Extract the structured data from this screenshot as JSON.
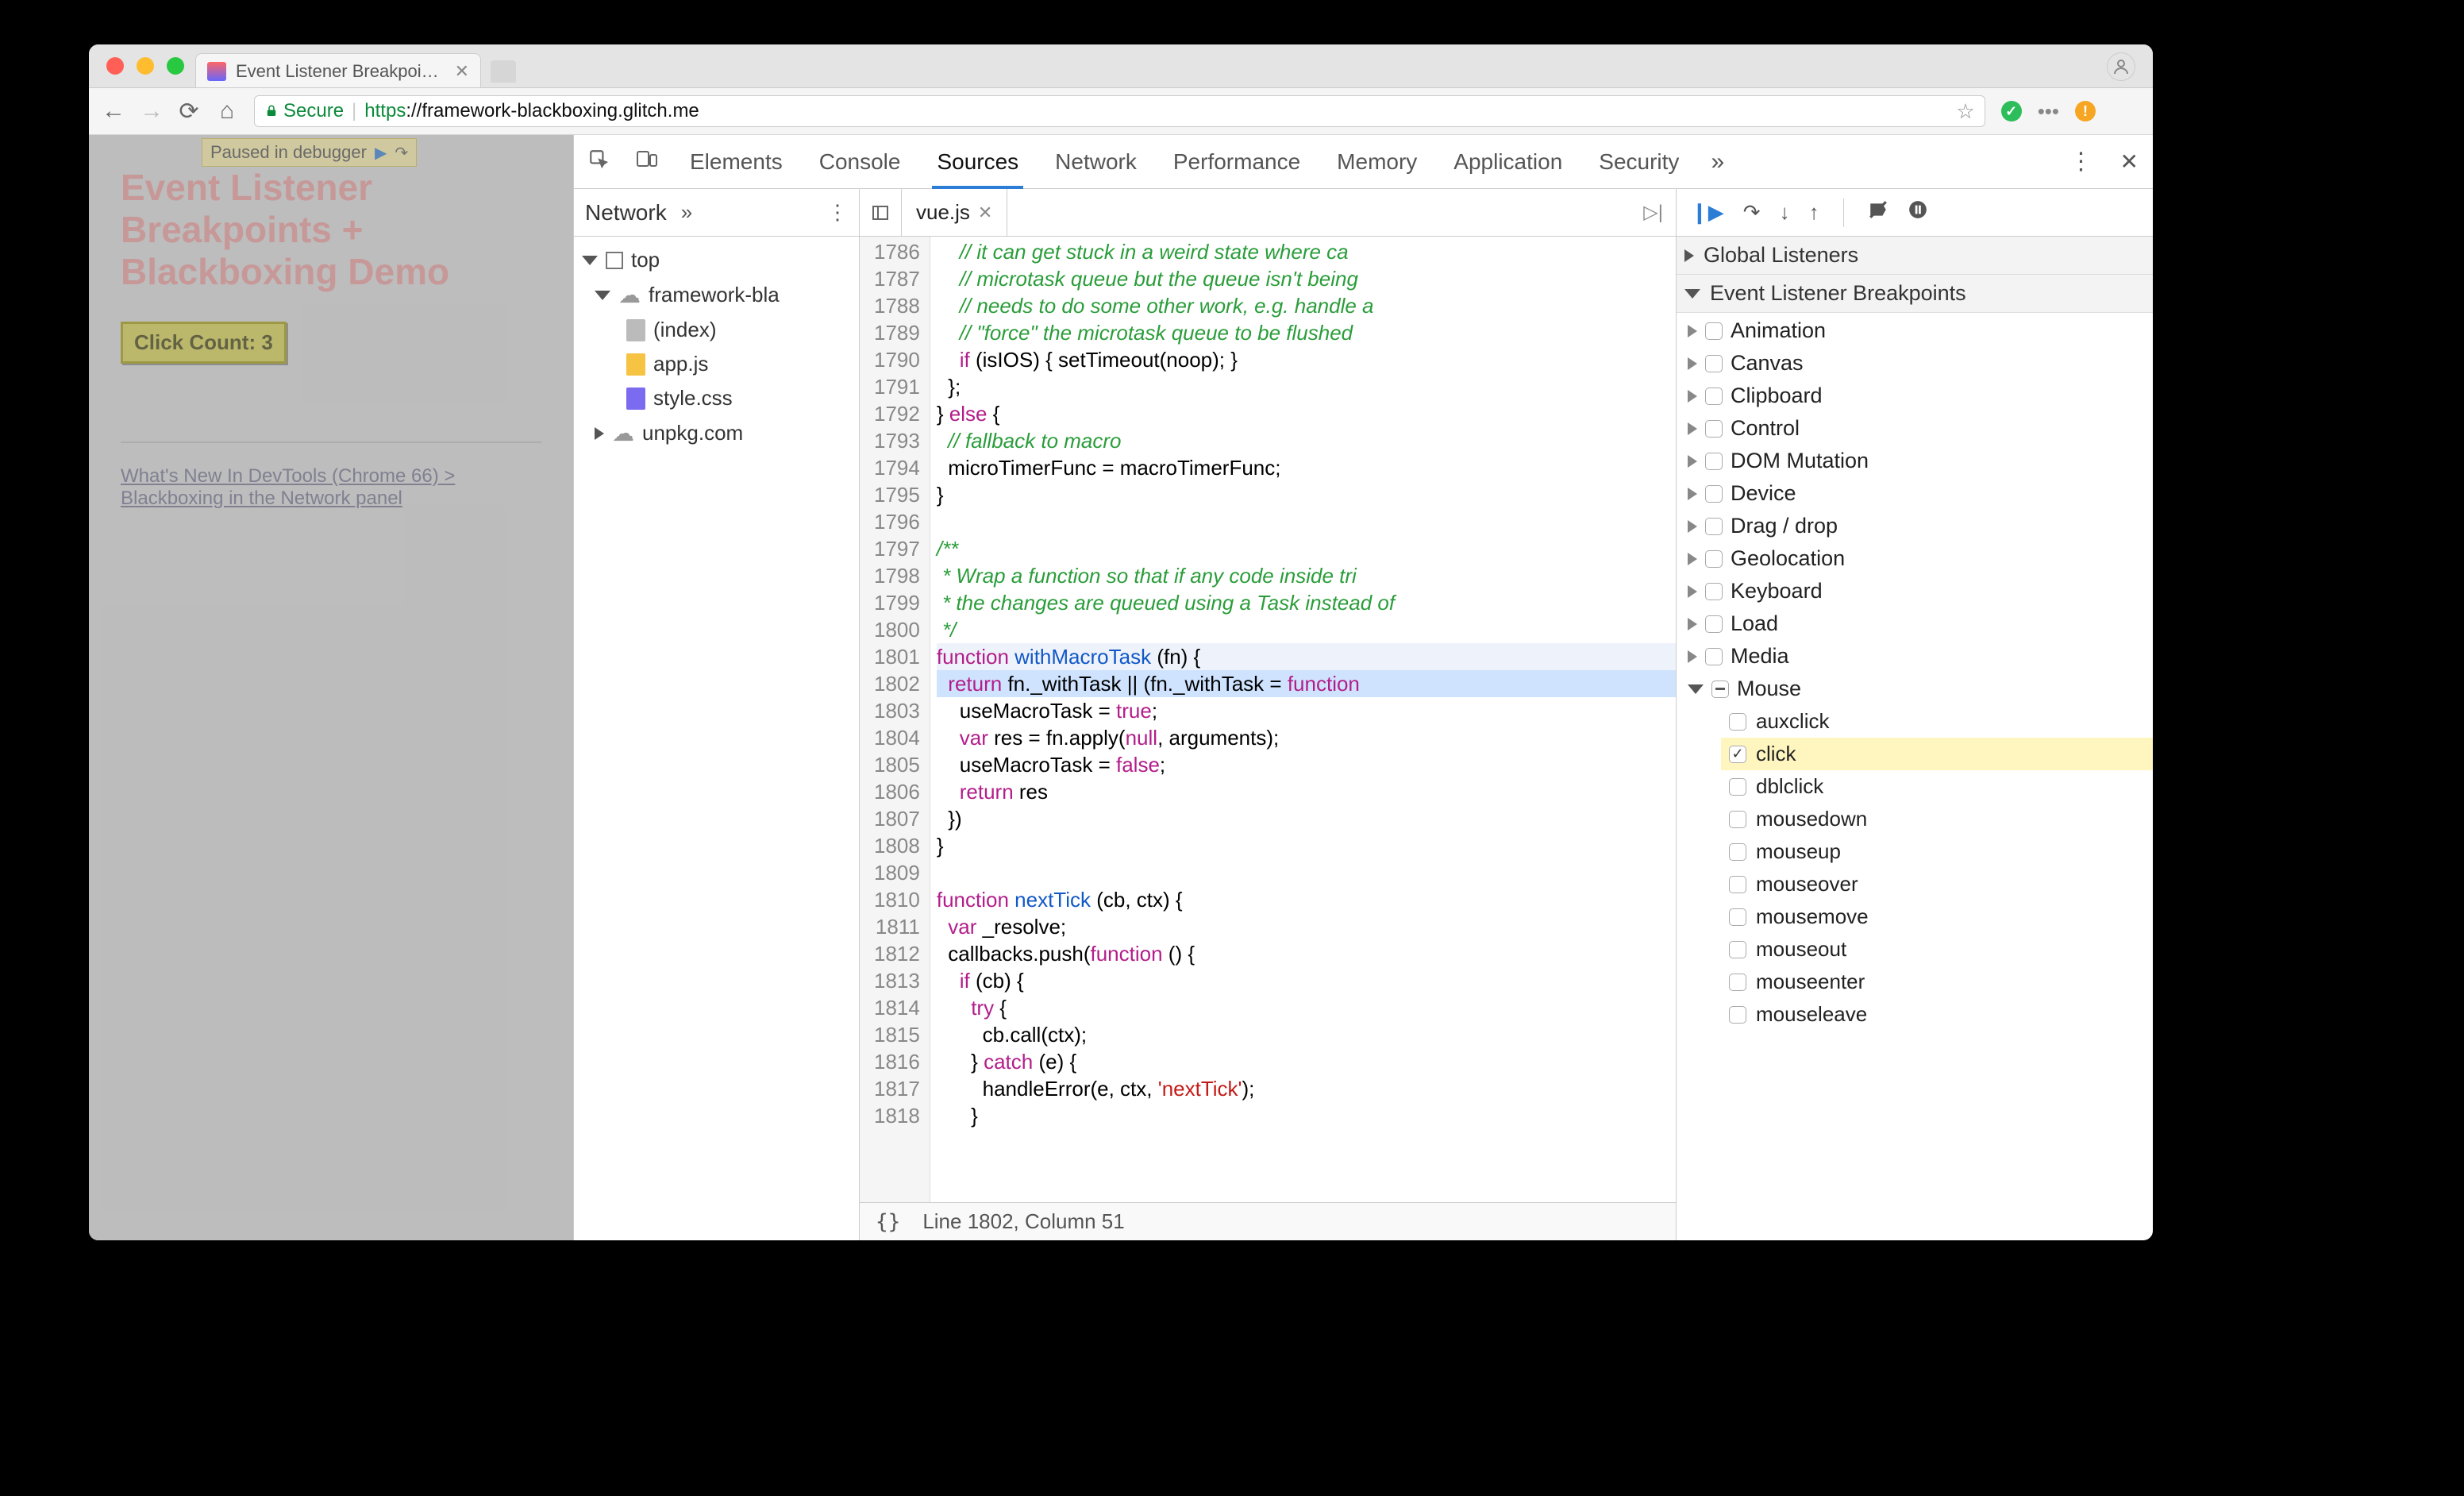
{
  "browser": {
    "tab_title": "Event Listener Breakpoints + B",
    "secure_label": "Secure",
    "url_proto": "https",
    "url_rest": "://framework-blackboxing.glitch.me"
  },
  "page": {
    "paused_label": "Paused in debugger",
    "heading": "Event Listener Breakpoints + Blackboxing Demo",
    "button_label": "Click Count: 3",
    "link_text": "What's New In DevTools (Chrome 66) > Blackboxing in the Network panel"
  },
  "devtools": {
    "tabs": [
      "Elements",
      "Console",
      "Sources",
      "Network",
      "Performance",
      "Memory",
      "Application",
      "Security"
    ],
    "active_tab": "Sources",
    "navigator": {
      "panel_label": "Network",
      "top": "top",
      "domain": "framework-bla",
      "files": [
        "(index)",
        "app.js",
        "style.css"
      ],
      "cdn": "unpkg.com"
    },
    "editor": {
      "filename": "vue.js",
      "first_line": 1786,
      "highlight_fn_line": 1801,
      "highlight_exec_line": 1802,
      "status": "Line 1802, Column 51",
      "lines": [
        {
          "n": 1786,
          "cls": "cm-comment",
          "t": "    // it can get stuck in a weird state where ca"
        },
        {
          "n": 1787,
          "cls": "cm-comment",
          "t": "    // microtask queue but the queue isn't being "
        },
        {
          "n": 1788,
          "cls": "cm-comment",
          "t": "    // needs to do some other work, e.g. handle a"
        },
        {
          "n": 1789,
          "cls": "cm-comment",
          "t": "    // \"force\" the microtask queue to be flushed"
        },
        {
          "n": 1790,
          "cls": "",
          "html": "    <span class='cm-kw'>if</span> (isIOS) { setTimeout(noop); }"
        },
        {
          "n": 1791,
          "cls": "",
          "t": "  };"
        },
        {
          "n": 1792,
          "cls": "",
          "html": "} <span class='cm-kw'>else</span> {"
        },
        {
          "n": 1793,
          "cls": "cm-comment",
          "t": "  // fallback to macro"
        },
        {
          "n": 1794,
          "cls": "",
          "t": "  microTimerFunc = macroTimerFunc;"
        },
        {
          "n": 1795,
          "cls": "",
          "t": "}"
        },
        {
          "n": 1796,
          "cls": "",
          "t": ""
        },
        {
          "n": 1797,
          "cls": "cm-comment",
          "t": "/**"
        },
        {
          "n": 1798,
          "cls": "cm-comment",
          "t": " * Wrap a function so that if any code inside tri"
        },
        {
          "n": 1799,
          "cls": "cm-comment",
          "t": " * the changes are queued using a Task instead of"
        },
        {
          "n": 1800,
          "cls": "cm-comment",
          "t": " */"
        },
        {
          "n": 1801,
          "cls": "",
          "html": "<span class='cm-kw'>function</span> <span class='cm-def'>withMacroTask</span> (fn) {"
        },
        {
          "n": 1802,
          "cls": "",
          "html": "  <span class='cm-kw'>return</span> fn._withTask || (fn._withTask = <span class='cm-kw'>function</span>"
        },
        {
          "n": 1803,
          "cls": "",
          "html": "    useMacroTask = <span class='cm-lit'>true</span>;"
        },
        {
          "n": 1804,
          "cls": "",
          "html": "    <span class='cm-kw'>var</span> res = fn.apply(<span class='cm-lit'>null</span>, arguments);"
        },
        {
          "n": 1805,
          "cls": "",
          "html": "    useMacroTask = <span class='cm-lit'>false</span>;"
        },
        {
          "n": 1806,
          "cls": "",
          "html": "    <span class='cm-kw'>return</span> res"
        },
        {
          "n": 1807,
          "cls": "",
          "t": "  })"
        },
        {
          "n": 1808,
          "cls": "",
          "t": "}"
        },
        {
          "n": 1809,
          "cls": "",
          "t": ""
        },
        {
          "n": 1810,
          "cls": "",
          "html": "<span class='cm-kw'>function</span> <span class='cm-def'>nextTick</span> (cb, ctx) {"
        },
        {
          "n": 1811,
          "cls": "",
          "html": "  <span class='cm-kw'>var</span> _resolve;"
        },
        {
          "n": 1812,
          "cls": "",
          "html": "  callbacks.push(<span class='cm-kw'>function</span> () {"
        },
        {
          "n": 1813,
          "cls": "",
          "html": "    <span class='cm-kw'>if</span> (cb) {"
        },
        {
          "n": 1814,
          "cls": "",
          "html": "      <span class='cm-kw'>try</span> {"
        },
        {
          "n": 1815,
          "cls": "",
          "t": "        cb.call(ctx);"
        },
        {
          "n": 1816,
          "cls": "",
          "html": "      } <span class='cm-kw'>catch</span> (e) {"
        },
        {
          "n": 1817,
          "cls": "",
          "html": "        handleError(e, ctx, <span class='cm-str'>'nextTick'</span>);"
        },
        {
          "n": 1818,
          "cls": "",
          "t": "      }"
        }
      ]
    },
    "debugger": {
      "sections": {
        "global": "Global Listeners",
        "elb": "Event Listener Breakpoints"
      },
      "categories": [
        {
          "name": "Animation",
          "open": false
        },
        {
          "name": "Canvas",
          "open": false
        },
        {
          "name": "Clipboard",
          "open": false
        },
        {
          "name": "Control",
          "open": false
        },
        {
          "name": "DOM Mutation",
          "open": false
        },
        {
          "name": "Device",
          "open": false
        },
        {
          "name": "Drag / drop",
          "open": false
        },
        {
          "name": "Geolocation",
          "open": false
        },
        {
          "name": "Keyboard",
          "open": false
        },
        {
          "name": "Load",
          "open": false
        },
        {
          "name": "Media",
          "open": false
        },
        {
          "name": "Mouse",
          "open": true,
          "mixed": true,
          "events": [
            {
              "name": "auxclick",
              "checked": false
            },
            {
              "name": "click",
              "checked": true
            },
            {
              "name": "dblclick",
              "checked": false
            },
            {
              "name": "mousedown",
              "checked": false
            },
            {
              "name": "mouseup",
              "checked": false
            },
            {
              "name": "mouseover",
              "checked": false
            },
            {
              "name": "mousemove",
              "checked": false
            },
            {
              "name": "mouseout",
              "checked": false
            },
            {
              "name": "mouseenter",
              "checked": false
            },
            {
              "name": "mouseleave",
              "checked": false
            }
          ]
        }
      ]
    }
  }
}
